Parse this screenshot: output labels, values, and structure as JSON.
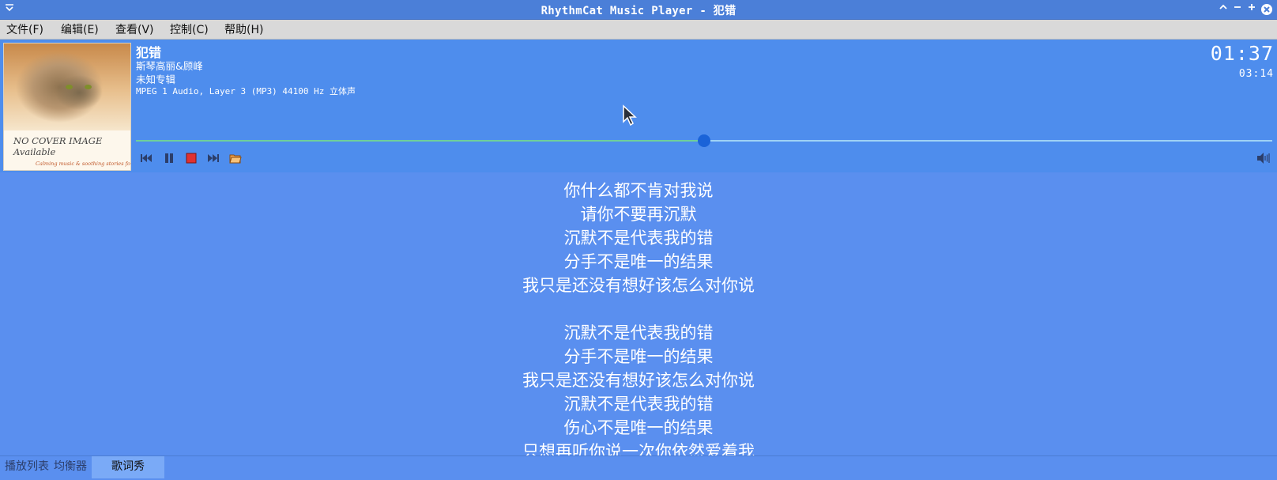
{
  "window": {
    "title": "RhythmCat Music Player - 犯错"
  },
  "menu": [
    "文件(F)",
    "编辑(E)",
    "查看(V)",
    "控制(C)",
    "帮助(H)"
  ],
  "cover": {
    "line1": "NO COVER IMAGE",
    "line2": "Available",
    "tagline": "Calming music & soothing stories for your cat"
  },
  "track": {
    "title": "犯错",
    "artist": "斯琴高丽&顾峰",
    "album": "未知专辑",
    "format": "MPEG 1 Audio, Layer 3 (MP3) 44100 Hz 立体声",
    "time_current": "01:37",
    "time_total": "03:14",
    "progress": 0.5
  },
  "controls": {
    "prev_icon": "skip-back-icon",
    "pause_icon": "pause-icon",
    "stop_icon": "stop-icon",
    "next_icon": "skip-forward-icon",
    "open_icon": "folder-open-icon",
    "volume_icon": "volume-icon"
  },
  "lyrics": [
    "你什么都不肯对我说",
    "请你不要再沉默",
    "沉默不是代表我的错",
    "分手不是唯一的结果",
    "我只是还没有想好该怎么对你说",
    "",
    "沉默不是代表我的错",
    "分手不是唯一的结果",
    "我只是还没有想好该怎么对你说",
    "沉默不是代表我的错",
    "伤心不是唯一的结果",
    "只想再听你说一次你依然爱着我"
  ],
  "tabs": [
    "播放列表",
    "均衡器",
    "歌词秀"
  ],
  "colors": {
    "panel": "#4e8ded",
    "background": "#5a8fef",
    "knob": "#1a63d8",
    "stop": "#e03131"
  }
}
